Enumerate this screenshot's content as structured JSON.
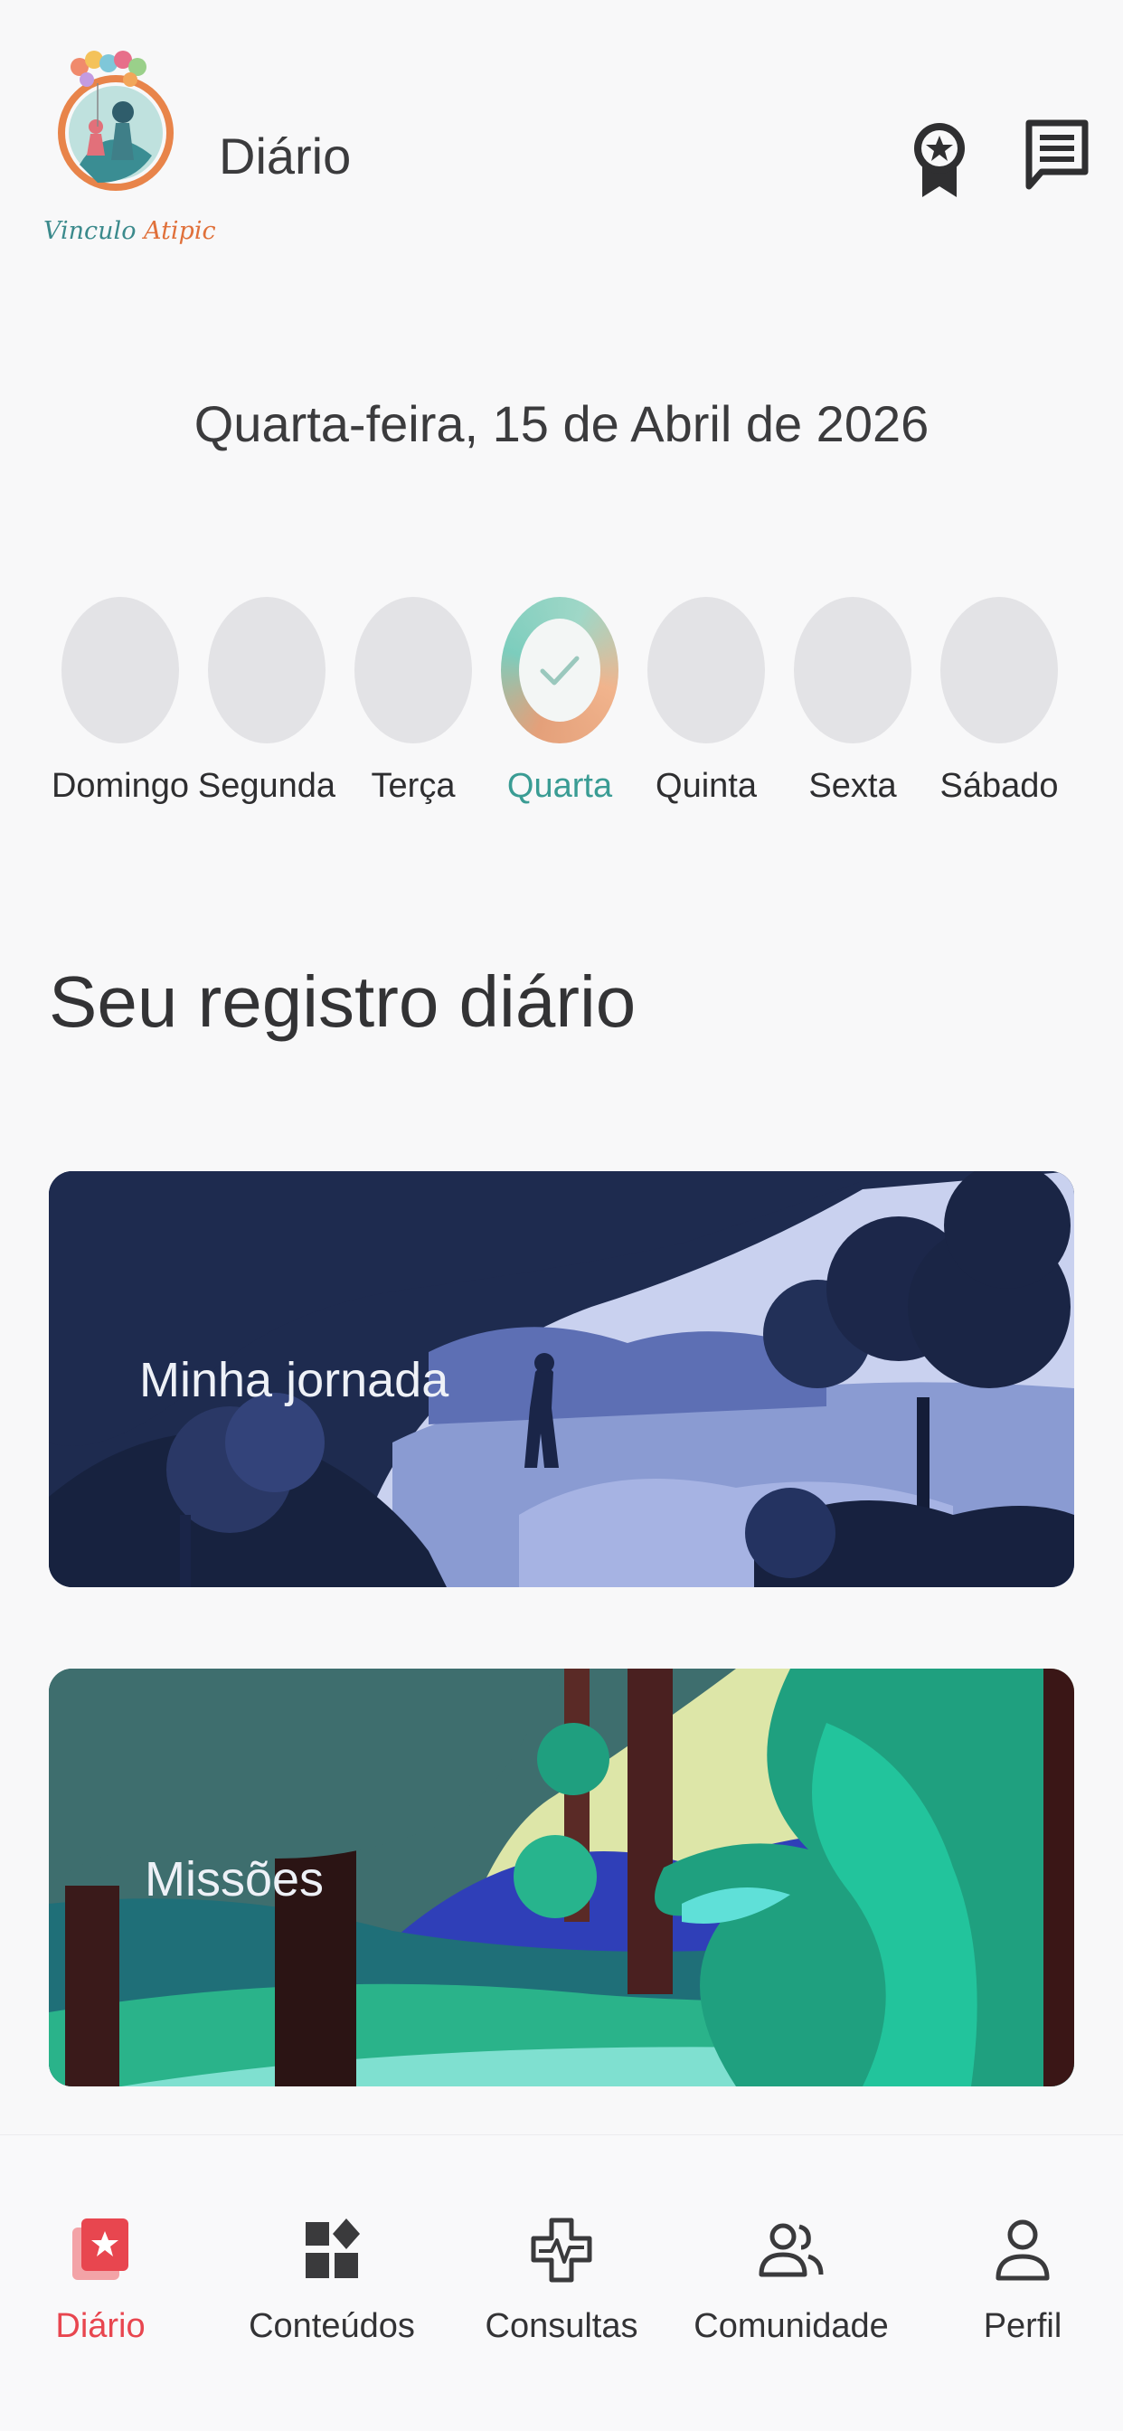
{
  "header": {
    "logo_text_a": "Vinculo ",
    "logo_text_b": "Atipic",
    "title": "Diário",
    "icons": [
      "award-badge-icon",
      "chat-message-icon"
    ]
  },
  "date": "Quarta-feira, 15 de Abril de 2026",
  "week": [
    {
      "label": "Domingo",
      "done": false
    },
    {
      "label": "Segunda",
      "done": false
    },
    {
      "label": "Terça",
      "done": false
    },
    {
      "label": "Quarta",
      "done": true
    },
    {
      "label": "Quinta",
      "done": false
    },
    {
      "label": "Sexta",
      "done": false
    },
    {
      "label": "Sábado",
      "done": false
    }
  ],
  "section_title": "Seu registro diário",
  "cards": {
    "journey": "Minha jornada",
    "missions": "Missões"
  },
  "nav": {
    "diario": "Diário",
    "conteudos": "Conteúdos",
    "consultas": "Consultas",
    "comunidade": "Comunidade",
    "perfil": "Perfil"
  },
  "colors": {
    "accent": "#e8464f",
    "active_day": "#3a9c94",
    "background": "#f8f8f9"
  }
}
